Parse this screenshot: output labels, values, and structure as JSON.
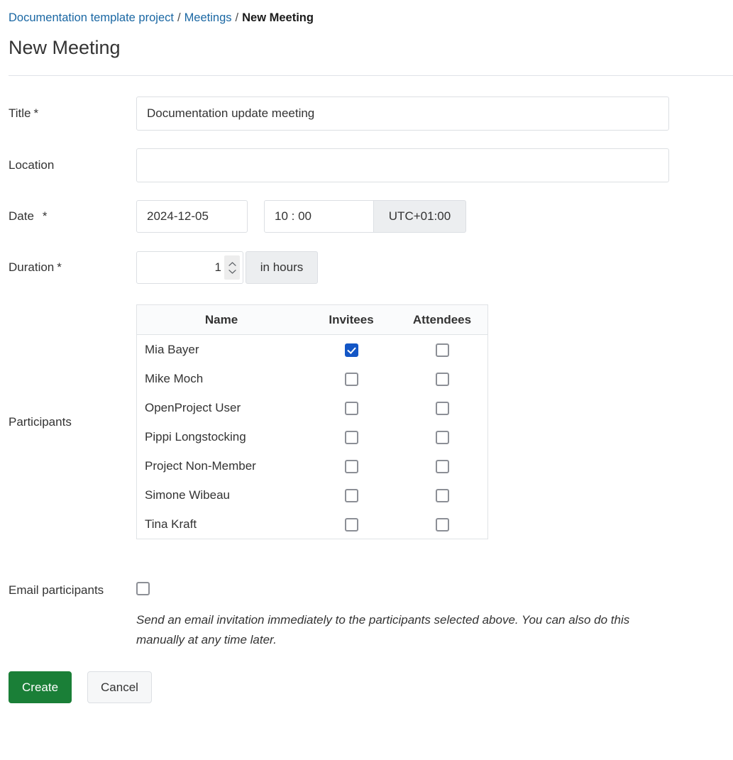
{
  "breadcrumb": {
    "project": "Documentation template project",
    "section": "Meetings",
    "current": "New Meeting",
    "separator": "/"
  },
  "page": {
    "title": "New Meeting"
  },
  "form": {
    "title_field": {
      "label": "Title",
      "required_marker": "*",
      "value": "Documentation update meeting",
      "placeholder": ""
    },
    "location_field": {
      "label": "Location",
      "value": "",
      "placeholder": ""
    },
    "date_field": {
      "label": "Date",
      "required_marker": "*",
      "date_value": "2024-12-05",
      "date_placeholder": "YYYY-MM-DD",
      "time_value": "10 : 00",
      "time_placeholder": "HH : MM",
      "timezone": "UTC+01:00"
    },
    "duration_field": {
      "label": "Duration",
      "required_marker": "*",
      "value": "1",
      "unit": "in hours"
    },
    "participants": {
      "label": "Participants",
      "columns": [
        "Name",
        "Invitees",
        "Attendees"
      ],
      "rows": [
        {
          "name": "Mia Bayer",
          "invitee": true,
          "attendee": false
        },
        {
          "name": "Mike Moch",
          "invitee": false,
          "attendee": false
        },
        {
          "name": "OpenProject User",
          "invitee": false,
          "attendee": false
        },
        {
          "name": "Pippi Longstocking",
          "invitee": false,
          "attendee": false
        },
        {
          "name": "Project Non-Member",
          "invitee": false,
          "attendee": false
        },
        {
          "name": "Simone Wibeau",
          "invitee": false,
          "attendee": false
        },
        {
          "name": "Tina Kraft",
          "invitee": false,
          "attendee": false
        }
      ]
    },
    "email_participants": {
      "label": "Email participants",
      "checked": false,
      "help_text": "Send an email invitation immediately to the participants selected above. You can also do this manually at any time later."
    }
  },
  "actions": {
    "create_label": "Create",
    "cancel_label": "Cancel"
  },
  "colors": {
    "link": "#1a67a3",
    "create_button": "#1a7f37",
    "checkbox_checked": "#1356c6",
    "checkbox_border": "#8c8f96",
    "input_border": "#dcdfe3",
    "addon_background": "#eceef0"
  }
}
